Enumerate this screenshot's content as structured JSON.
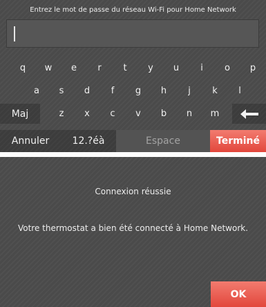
{
  "keyboard_screen": {
    "prompt": "Entrez le mot de passe du réseau Wi-Fi pour Home Network",
    "password_value": "",
    "rows": [
      [
        "q",
        "w",
        "e",
        "r",
        "t",
        "y",
        "u",
        "i",
        "o",
        "p"
      ],
      [
        "a",
        "s",
        "d",
        "f",
        "g",
        "h",
        "j",
        "k",
        "l"
      ],
      [
        "z",
        "x",
        "c",
        "v",
        "b",
        "n",
        "m"
      ]
    ],
    "shift_label": "Maj",
    "backspace_icon": "left-arrow-backspace-icon",
    "cancel_label": "Annuler",
    "symbols_label": "12.?éà",
    "space_label": "Espace",
    "done_label": "Terminé"
  },
  "success_screen": {
    "title": "Connexion réussie",
    "message": "Votre thermostat a bien été connecté à Home Network.",
    "ok_label": "OK"
  },
  "colors": {
    "panel_bg": "#4a4a4a",
    "accent": "#e8554a",
    "text": "#f0f0f0",
    "space_text": "#a3a3a3"
  }
}
